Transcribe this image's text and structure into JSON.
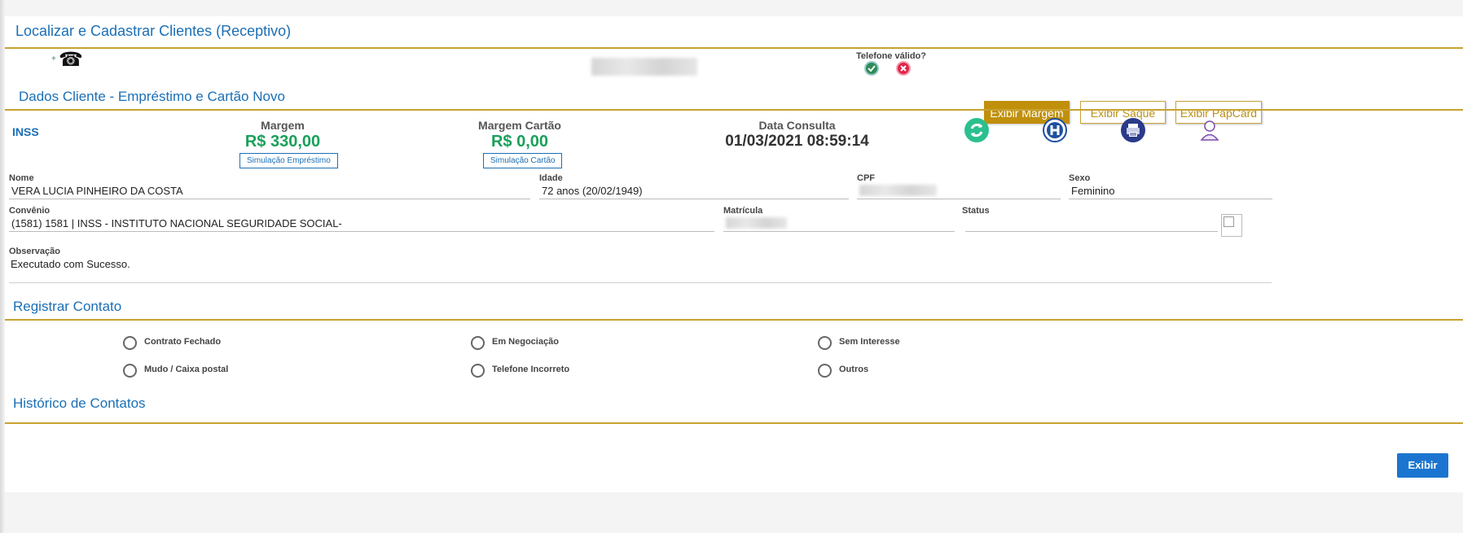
{
  "header": {
    "title": "Localizar e Cadastrar Clientes (Receptivo)"
  },
  "phone": {
    "plus": "+",
    "phone_glyph": "☎",
    "valid_label": "Telefone válido?"
  },
  "client_section": {
    "title": "Dados Cliente - Empréstimo e Cartão Novo",
    "tabs": [
      "Exibir Margem",
      "Exibir Saque",
      "Exibir PapCard"
    ],
    "active_tab": "Exibir Margem",
    "inss_label": "INSS",
    "margem": {
      "label": "Margem",
      "value": "R$ 330,00",
      "button": "Simulação Empréstimo"
    },
    "margem_cartao": {
      "label": "Margem Cartão",
      "value": "R$ 0,00",
      "button": "Simulação Cartão"
    },
    "data_consulta": {
      "label": "Data Consulta",
      "value": "01/03/2021 08:59:14"
    },
    "action_icons": [
      "refresh-icon",
      "h-circle-icon",
      "printer-icon",
      "user-icon"
    ]
  },
  "fields": {
    "nome": {
      "label": "Nome",
      "value": "VERA LUCIA PINHEIRO DA COSTA"
    },
    "idade": {
      "label": "Idade",
      "value": "72 anos (20/02/1949)"
    },
    "cpf": {
      "label": "CPF"
    },
    "sexo": {
      "label": "Sexo",
      "value": "Feminino"
    },
    "convenio": {
      "label": "Convênio",
      "value": "(1581) 1581 | INSS - INSTITUTO NACIONAL SEGURIDADE SOCIAL-"
    },
    "matricula": {
      "label": "Matrícula"
    },
    "status": {
      "label": "Status",
      "value": ""
    },
    "observacao": {
      "label": "Observação",
      "value": "Executado com Sucesso."
    }
  },
  "contact": {
    "title": "Registrar Contato",
    "options": [
      "Contrato Fechado",
      "Em Negociação",
      "Sem Interesse",
      "Mudo / Caixa postal",
      "Telefone Incorreto",
      "Outros"
    ]
  },
  "history": {
    "title": "Histórico de Contatos",
    "button": "Exibir"
  },
  "colors": {
    "brand_blue": "#1b6fb5",
    "gold": "#c0900b",
    "money_green": "#1aa05a",
    "valid_green": "#2e8b57",
    "invalid_red": "#e0254a"
  }
}
